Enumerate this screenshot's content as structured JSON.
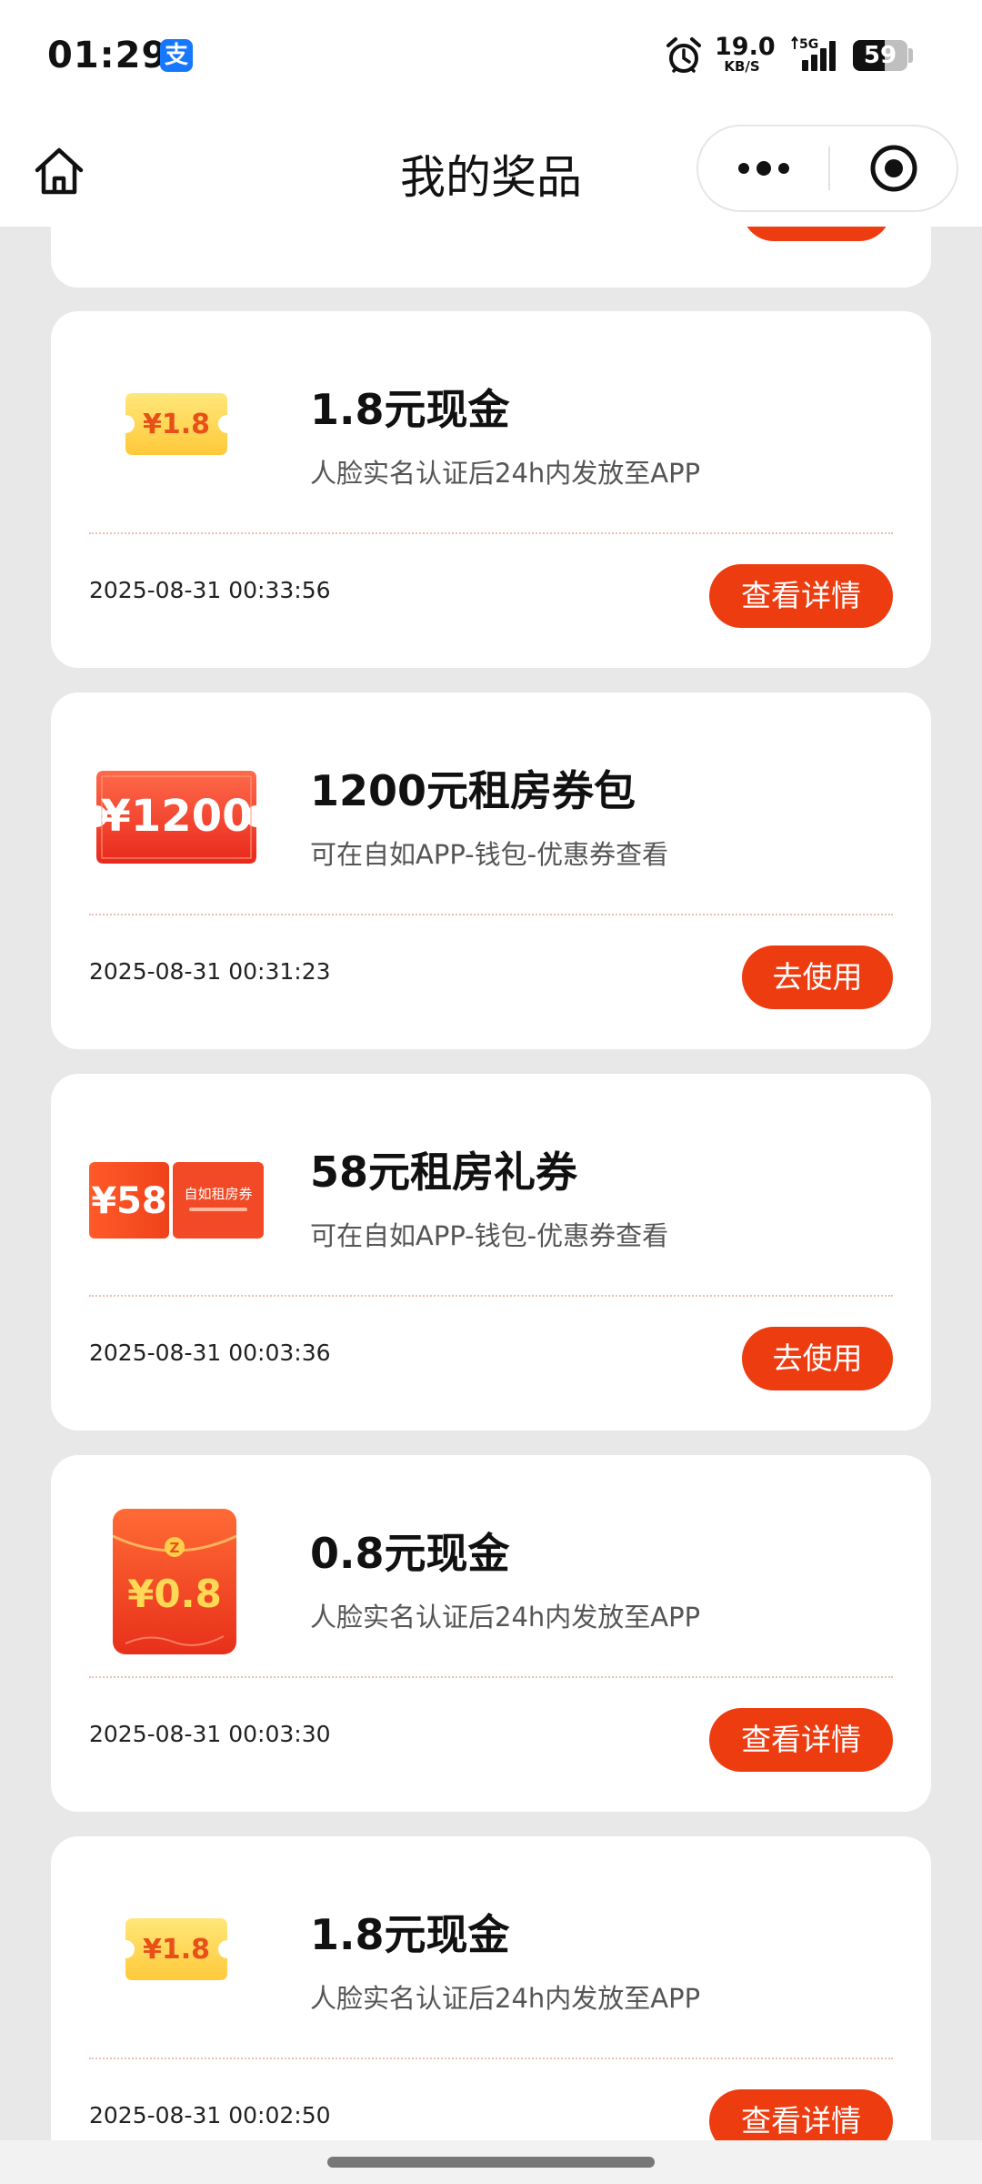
{
  "status_bar": {
    "time": "01:29",
    "alipay_icon_glyph": "支",
    "net_speed_value": "19.0",
    "net_speed_unit": "KB/S",
    "network_type": "5G",
    "battery_percent": "59",
    "icons": [
      "alipay-icon",
      "alarm-icon",
      "signal-5g-icon",
      "battery-icon"
    ]
  },
  "nav": {
    "title": "我的奖品",
    "icons": [
      "home-icon",
      "more-dots-icon",
      "close-target-icon"
    ]
  },
  "prizes": [
    {
      "title": "1.8元现金",
      "description": "人脸实名认证后24h内发放至APP",
      "image_label": "¥1.8",
      "image_type": "cash-ticket",
      "timestamp": "2025-08-31 00:33:56",
      "action": "查看详情"
    },
    {
      "title": "1200元租房券包",
      "description": "可在自如APP-钱包-优惠券查看",
      "image_label": "¥1200",
      "image_type": "rent-coupon-pack",
      "timestamp": "2025-08-31 00:31:23",
      "action": "去使用"
    },
    {
      "title": "58元租房礼券",
      "description": "可在自如APP-钱包-优惠券查看",
      "image_label": "¥58",
      "image_stub_label": "自如租房券",
      "image_type": "rent-gift-coupon",
      "timestamp": "2025-08-31 00:03:36",
      "action": "去使用"
    },
    {
      "title": "0.8元现金",
      "description": "人脸实名认证后24h内发放至APP",
      "image_label": "¥0.8",
      "image_badge": "Z",
      "image_type": "red-envelope",
      "timestamp": "2025-08-31 00:03:30",
      "action": "查看详情"
    },
    {
      "title": "1.8元现金",
      "description": "人脸实名认证后24h内发放至APP",
      "image_label": "¥1.8",
      "image_type": "cash-ticket",
      "timestamp": "2025-08-31 00:02:50",
      "action": "查看详情"
    }
  ],
  "colors": {
    "accent": "#ee3c11",
    "background": "#e8e8e8",
    "card": "#ffffff",
    "ticket_yellow": "#ffd955",
    "ticket_text": "#e8501a"
  }
}
